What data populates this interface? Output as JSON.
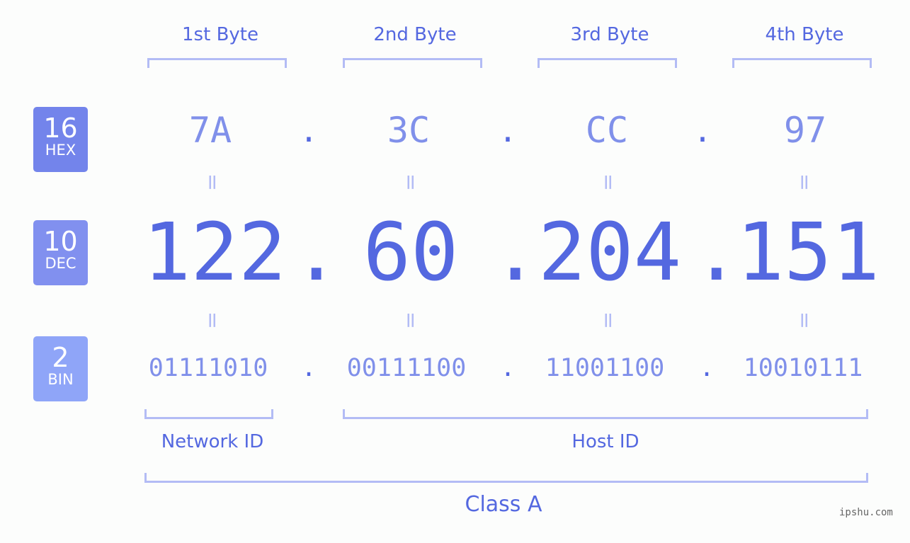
{
  "bytes": [
    {
      "label": "1st Byte",
      "hex": "7A",
      "dec": "122",
      "bin": "01111010"
    },
    {
      "label": "2nd Byte",
      "hex": "3C",
      "dec": "60",
      "bin": "00111100"
    },
    {
      "label": "3rd Byte",
      "hex": "CC",
      "dec": "204",
      "bin": "11001100"
    },
    {
      "label": "4th Byte",
      "hex": "97",
      "dec": "151",
      "bin": "10010111"
    }
  ],
  "bases": {
    "hex": {
      "num": "16",
      "label": "HEX",
      "color": "#7384eb"
    },
    "dec": {
      "num": "10",
      "label": "DEC",
      "color": "#8190ef"
    },
    "bin": {
      "num": "2",
      "label": "BIN",
      "color": "#8fa5f8"
    }
  },
  "separator": ".",
  "equals": "=",
  "groups": {
    "network": "Network ID",
    "host": "Host ID",
    "class": "Class A"
  },
  "watermark": "ipshu.com"
}
